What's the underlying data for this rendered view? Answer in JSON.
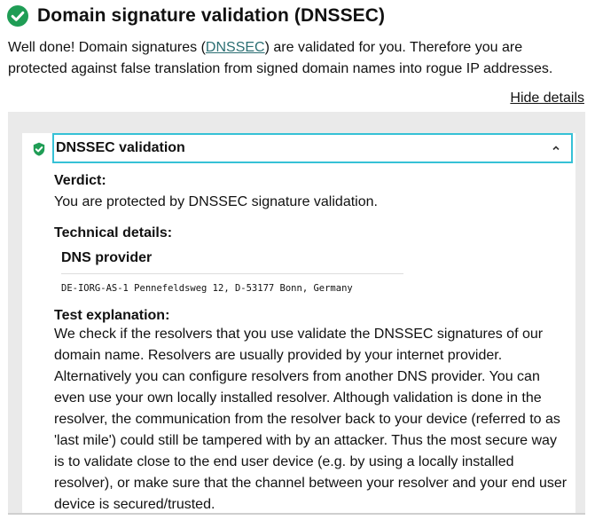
{
  "header": {
    "title": "Domain signature validation (DNSSEC)",
    "status_color": "#1f9d55"
  },
  "intro": {
    "text_before": "Well done! Domain signatures (",
    "link_text": "DNSSEC",
    "text_after": ") are validated for you. Therefore you are protected against false translation from signed domain names into rogue IP addresses."
  },
  "hide_details_label": "Hide details",
  "accordion": {
    "title": "DNSSEC validation",
    "verdict_label": "Verdict:",
    "verdict_text": "You are protected by DNSSEC signature validation.",
    "technical_label": "Technical details:",
    "provider_header": "DNS provider",
    "provider_value": "DE-IORG-AS-1 Pennefeldsweg 12, D-53177 Bonn, Germany",
    "explanation_label": "Test explanation:",
    "explanation_text": "We check if the resolvers that you use validate the DNSSEC signatures of our domain name. Resolvers are usually provided by your internet provider. Alternatively you can configure resolvers from another DNS provider. You can even use your own locally installed resolver. Although validation is done in the resolver, the communication from the resolver back to your device (referred to as 'last mile') could still be tampered with by an attacker. Thus the most secure way is to validate close to the end user device (e.g. by using a locally installed resolver), or make sure that the channel between your resolver and your end user device is secured/trusted."
  },
  "icons": {
    "status": "check-circle-icon",
    "collapse": "chevron-up-icon"
  }
}
